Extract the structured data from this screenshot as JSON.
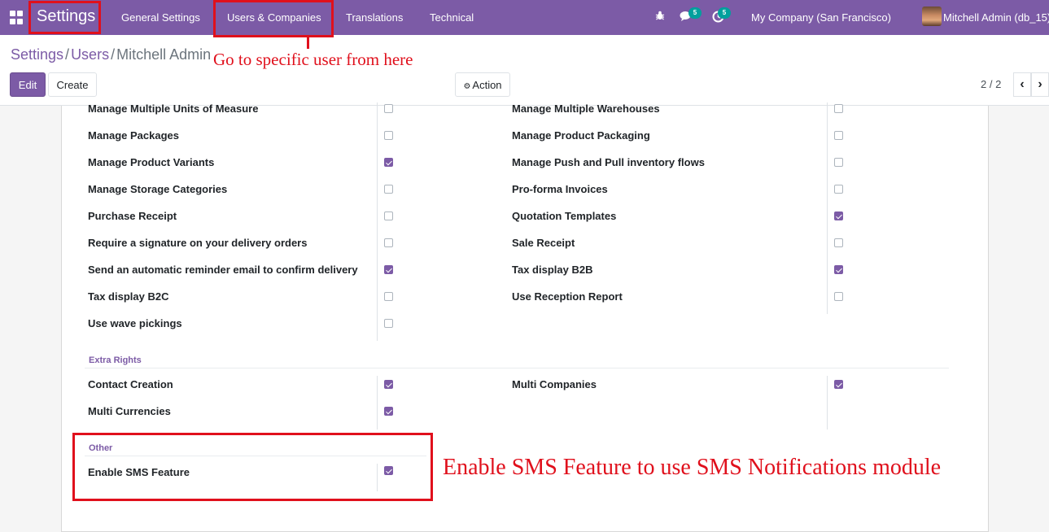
{
  "navbar": {
    "app_title": "Settings",
    "menu": [
      "General Settings",
      "Users & Companies",
      "Translations",
      "Technical"
    ],
    "messages_badge": "5",
    "activities_badge": "5",
    "company": "My Company (San Francisco)",
    "user": "Mitchell Admin (db_15)"
  },
  "breadcrumb": {
    "items": [
      "Settings",
      "Users"
    ],
    "current": "Mitchell Admin"
  },
  "buttons": {
    "edit": "Edit",
    "create": "Create",
    "action": "Action"
  },
  "pager": {
    "value": "2 / 2"
  },
  "rights": {
    "left": [
      {
        "label": "Manage Multiple Units of Measure",
        "checked": false
      },
      {
        "label": "Manage Packages",
        "checked": false
      },
      {
        "label": "Manage Product Variants",
        "checked": true
      },
      {
        "label": "Manage Storage Categories",
        "checked": false
      },
      {
        "label": "Purchase Receipt",
        "checked": false
      },
      {
        "label": "Require a signature on your delivery orders",
        "checked": false
      },
      {
        "label": "Send an automatic reminder email to confirm delivery",
        "checked": true
      },
      {
        "label": "Tax display B2C",
        "checked": false
      },
      {
        "label": "Use wave pickings",
        "checked": false
      }
    ],
    "right": [
      {
        "label": "Manage Multiple Warehouses",
        "checked": false
      },
      {
        "label": "Manage Product Packaging",
        "checked": false
      },
      {
        "label": "Manage Push and Pull inventory flows",
        "checked": false
      },
      {
        "label": "Pro-forma Invoices",
        "checked": false
      },
      {
        "label": "Quotation Templates",
        "checked": true
      },
      {
        "label": "Sale Receipt",
        "checked": false
      },
      {
        "label": "Tax display B2B",
        "checked": true
      },
      {
        "label": "Use Reception Report",
        "checked": false
      }
    ]
  },
  "extra_rights": {
    "title": "Extra Rights",
    "left": [
      {
        "label": "Contact Creation",
        "checked": true
      },
      {
        "label": "Multi Currencies",
        "checked": true
      }
    ],
    "right": [
      {
        "label": "Multi Companies",
        "checked": true
      }
    ]
  },
  "other": {
    "title": "Other",
    "items": [
      {
        "label": "Enable SMS Feature",
        "checked": true
      }
    ]
  },
  "annotations": {
    "users_note": "Go to specific user from here",
    "sms_note": "Enable SMS Feature to use SMS Notifications module"
  },
  "colors": {
    "primary": "#7c5ba6",
    "badge": "#00a09d",
    "annotation": "#e0101c"
  }
}
